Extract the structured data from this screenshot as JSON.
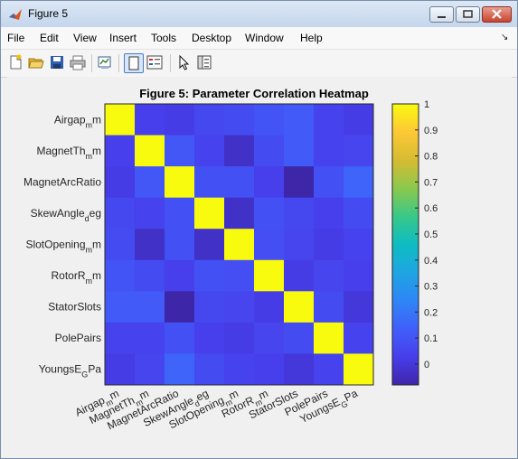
{
  "window": {
    "title": "Figure 5"
  },
  "menu": [
    "File",
    "Edit",
    "View",
    "Insert",
    "Tools",
    "Desktop",
    "Window",
    "Help"
  ],
  "toolbar": {
    "buttons": [
      "new-figure-icon",
      "open-icon",
      "save-icon",
      "print-icon",
      "link-plot-icon",
      "toggle-figure-icon",
      "insert-legend-icon",
      "pointer-icon",
      "property-inspector-icon"
    ]
  },
  "chart_data": {
    "type": "heatmap",
    "title": "Figure 5: Parameter Correlation Heatmap",
    "labels": [
      "Airgap_mm",
      "MagnetTh_mm",
      "MagnetArcRatio",
      "SkewAngle_deg",
      "SlotOpening_mm",
      "RotorR_mm",
      "StatorSlots",
      "PolePairs",
      "YoungsE_GPa"
    ],
    "values": [
      [
        1.0,
        0.03,
        0.02,
        0.06,
        0.07,
        0.1,
        0.12,
        0.04,
        0.02
      ],
      [
        0.03,
        1.0,
        0.11,
        0.04,
        -0.03,
        0.07,
        0.12,
        0.04,
        0.05
      ],
      [
        0.02,
        0.11,
        1.0,
        0.09,
        0.09,
        0.03,
        -0.08,
        0.09,
        0.15
      ],
      [
        0.06,
        0.04,
        0.09,
        1.0,
        -0.03,
        0.09,
        0.06,
        0.03,
        0.07
      ],
      [
        0.07,
        -0.03,
        0.09,
        -0.03,
        1.0,
        0.08,
        0.05,
        0.02,
        0.04
      ],
      [
        0.1,
        0.07,
        0.03,
        0.09,
        0.08,
        1.0,
        0.02,
        0.05,
        0.03
      ],
      [
        0.12,
        0.12,
        -0.08,
        0.06,
        0.05,
        0.02,
        1.0,
        0.07,
        0.0
      ],
      [
        0.04,
        0.04,
        0.09,
        0.03,
        0.02,
        0.05,
        0.07,
        1.0,
        0.04
      ],
      [
        0.02,
        0.05,
        0.15,
        0.07,
        0.04,
        0.03,
        0.0,
        0.04,
        1.0
      ]
    ],
    "clim": [
      -0.08,
      1
    ],
    "colorbar_ticks": [
      "0",
      "0.1",
      "0.2",
      "0.3",
      "0.4",
      "0.5",
      "0.6",
      "0.7",
      "0.8",
      "0.9",
      "1"
    ],
    "colormap": "parula"
  }
}
